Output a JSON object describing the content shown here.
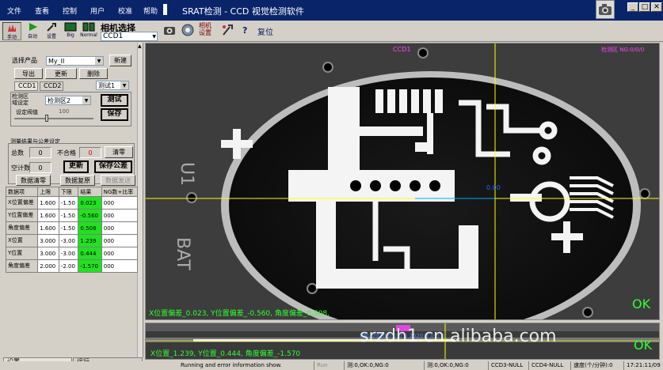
{
  "menu": {
    "items": [
      "文件",
      "查看",
      "控制",
      "用户",
      "校准",
      "帮助"
    ],
    "app_title": "SRAT检测 - CCD 视觉检测软件"
  },
  "window_controls": {
    "minimize": "_",
    "restore": "□",
    "close": "✕"
  },
  "toolbar": {
    "manual": "手动",
    "auto": "自动",
    "settings": "设置",
    "big": "Big",
    "normal": "Normal",
    "camera_select_label": "相机选择",
    "camera_select_value": "CCD1",
    "camera_settings": "相机\n设置",
    "reset": "复位"
  },
  "left_panel": {
    "product_label": "选择产品",
    "product_value": "My_II",
    "new_button": "新建",
    "export_button": "导出",
    "update_button": "更新",
    "delete_button": "删除",
    "tabs": [
      "CCD1",
      "CCD2"
    ],
    "test_mode_value": "测试1",
    "region_label": "检测区\n域设定",
    "region_value": "检测区2",
    "test_button": "测试",
    "threshold_label": "设定阀值",
    "threshold_value": "100",
    "save_button": "保存",
    "results_group_label": "测量结果与公差设定",
    "total_label": "总数",
    "total_value": "0",
    "ng_label": "不合格",
    "ng_value": "0",
    "clear_button": "清零",
    "idle_label": "空计数",
    "idle_value": "0",
    "refresh_button": "更新",
    "save_tolerance_button": "保存公差",
    "data_clear_button": "数据清零",
    "data_restore_button": "数据复原",
    "data_send_button": "数据发送"
  },
  "table": {
    "headers": [
      "数据项",
      "上限",
      "下限",
      "结果",
      "NG数+比率"
    ],
    "rows": [
      {
        "name": "X位置偏差",
        "upper": "1.600",
        "lower": "-1.50",
        "result": "0.023",
        "ng": "000"
      },
      {
        "name": "Y位置偏差",
        "upper": "1.600",
        "lower": "-1.50",
        "result": "-0.560",
        "ng": "000"
      },
      {
        "name": "角度偏差",
        "upper": "1.600",
        "lower": "-1.50",
        "result": "0.508",
        "ng": "000"
      },
      {
        "name": "X位置",
        "upper": "3.000",
        "lower": "-3.00",
        "result": "1.239",
        "ng": "000"
      },
      {
        "name": "Y位置",
        "upper": "3.000",
        "lower": "-3.00",
        "result": "0.444",
        "ng": "000"
      },
      {
        "name": "角度偏差",
        "upper": "2.000",
        "lower": "-2.00",
        "result": "-1.570",
        "ng": "000"
      }
    ]
  },
  "bottom_tabs": [
    "设置",
    "运行"
  ],
  "view1": {
    "label": "CCD1",
    "top_right": "检测区 NG:0/0/0",
    "center_value": "0.00",
    "overlay_text": "X位置偏差_0.023, Y位置偏差_-0.560, 角度偏差_0.508,",
    "ok_text": "OK"
  },
  "view2": {
    "overlay_text": "X位置_1.239, Y位置_0.444, 角度偏差_-1.570",
    "ok_text": "OK",
    "watermark": "srzdh1.cn.alibaba.com",
    "faint_text": "XBL 2020 0 0 0 0    2020 0 0 0 0"
  },
  "status_bar": {
    "message": "Running and error information show.",
    "mode": "Run",
    "ccd1_count": "测:0,OK:0,NG:0",
    "ccd2_count": "测:0,OK:0,NG:0",
    "ccd3": "CCD3-NULL",
    "ccd4": "CCD4-NULL",
    "speed": "速度(个/分钟):0",
    "time": "17:21:11/09"
  },
  "colors": {
    "menubar_bg": "#0a246a",
    "ok_green": "#22e022",
    "overlay_green": "#30ff30",
    "crosshair": "#ffff00",
    "label_magenta": "#ff44ff"
  }
}
